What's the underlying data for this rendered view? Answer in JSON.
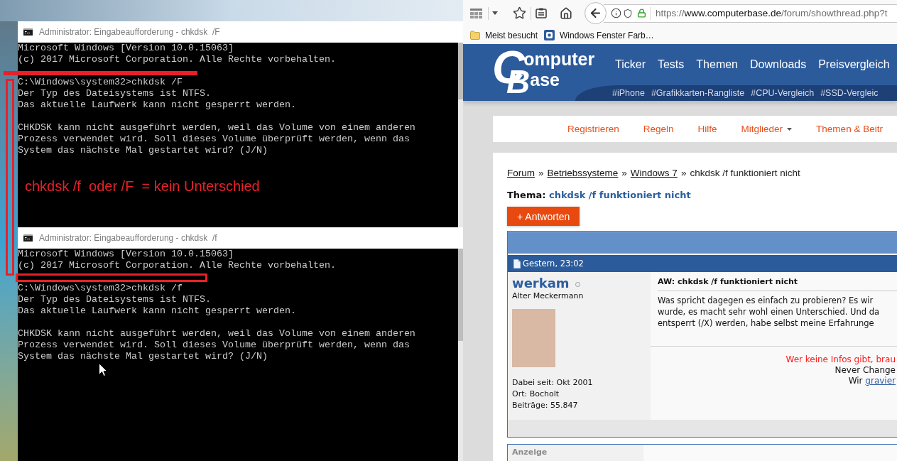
{
  "console_windows": [
    {
      "title": "Administrator: Eingabeaufforderung - chkdsk  /F",
      "blocks": [
        [
          "Microsoft Windows [Version 10.0.15063]",
          "(c) 2017 Microsoft Corporation. Alle Rechte vorbehalten."
        ],
        [
          "C:\\Windows\\system32>chkdsk /F",
          "Der Typ des Dateisystems ist NTFS.",
          "Das aktuelle Laufwerk kann nicht gesperrt werden."
        ],
        [
          "CHKDSK kann nicht ausgeführt werden, weil das Volume von einem anderen",
          "Prozess verwendet wird. Soll dieses Volume überprüft werden, wenn das",
          "System das nächste Mal gestartet wird? (J/N)"
        ]
      ]
    },
    {
      "title": "Administrator: Eingabeaufforderung - chkdsk  /f",
      "blocks": [
        [
          "Microsoft Windows [Version 10.0.15063]",
          "(c) 2017 Microsoft Corporation. Alle Rechte vorbehalten."
        ],
        [
          "C:\\Windows\\system32>chkdsk /f",
          "Der Typ des Dateisystems ist NTFS.",
          "Das aktuelle Laufwerk kann nicht gesperrt werden."
        ],
        [
          "CHKDSK kann nicht ausgeführt werden, weil das Volume von einem anderen",
          "Prozess verwendet wird. Soll dieses Volume überprüft werden, wenn das",
          "System das nächste Mal gestartet wird? (J/N)"
        ]
      ]
    }
  ],
  "annotation": {
    "text": "chkdsk /f  oder /F  = kein Unterschied"
  },
  "browser": {
    "url": {
      "scheme": "https://",
      "host": "www.computerbase.de",
      "path": "/forum/showthread.php?t"
    },
    "bookmarks": [
      {
        "kind": "folder",
        "label": "Meist besucht"
      },
      {
        "kind": "site",
        "label": "Windows Fenster Farb…"
      }
    ]
  },
  "site_header": {
    "logo": [
      {
        "initial": "C",
        "rest": "omputer"
      },
      {
        "initial": "B",
        "rest": "ase"
      }
    ],
    "nav": [
      "Ticker",
      "Tests",
      "Themen",
      "Downloads",
      "Preisvergleich"
    ],
    "hashtags": [
      "#iPhone",
      "#Grafikkarten-Rangliste",
      "#CPU-Vergleich",
      "#SSD-Vergleic"
    ]
  },
  "forum_nav": [
    {
      "label": "Registrieren",
      "dropdown": false
    },
    {
      "label": "Regeln",
      "dropdown": false
    },
    {
      "label": "Hilfe",
      "dropdown": false
    },
    {
      "label": "Mitglieder",
      "dropdown": true
    },
    {
      "label": "Themen & Beitr",
      "dropdown": false
    }
  ],
  "breadcrumb": [
    {
      "kind": "link",
      "label": "Forum"
    },
    {
      "kind": "separator",
      "label": "»"
    },
    {
      "kind": "link",
      "label": "Betriebssysteme"
    },
    {
      "kind": "separator",
      "label": "»"
    },
    {
      "kind": "link",
      "label": "Windows 7"
    },
    {
      "kind": "separator",
      "label": "»"
    },
    {
      "kind": "current",
      "label": "chkdsk /f funktioniert nicht"
    }
  ],
  "thread": {
    "label": "Thema:",
    "title": "chkdsk /f funktioniert nicht"
  },
  "reply_button": {
    "label": "+ Antworten"
  },
  "posts": [
    {
      "date": "Gestern, 23:02",
      "author": {
        "name": "werkam",
        "online": false,
        "rank": "Alter Meckermann",
        "details": [
          "Dabei seit: Okt 2001",
          "Ort: Bocholt",
          "Beiträge: 55.847"
        ]
      },
      "title": "AW: chkdsk /f funktioniert nicht",
      "body_lines": [
        "Was spricht dagegen es einfach zu probieren? Es wir",
        "wurde, es macht sehr wohl einen Unterschied. Und da",
        "entsperrt (/X) werden, habe selbst meine Erfahrunge"
      ],
      "signature": [
        {
          "kind": "warning",
          "text": "Wer keine Infos gibt, brau"
        },
        {
          "kind": "plain",
          "text": "Never Change"
        },
        {
          "kind": "link",
          "text": "Wir",
          "link": "gravier"
        }
      ]
    }
  ],
  "ad": {
    "label": "Anzeige"
  }
}
